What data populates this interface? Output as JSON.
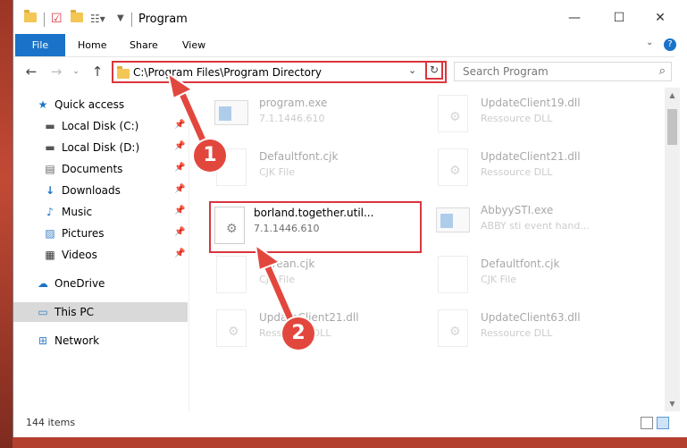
{
  "window": {
    "title": "Program",
    "controls": {
      "minimize": "—",
      "maximize": "☐",
      "close": "✕"
    }
  },
  "ribbon": {
    "tabs": [
      "File",
      "Home",
      "Share",
      "View"
    ],
    "help": "?"
  },
  "nav": {
    "address": "C:\\Program Files\\Program Directory",
    "search_placeholder": "Search Program"
  },
  "sidebar": {
    "items": [
      {
        "label": "Quick access",
        "icon": "star-icon",
        "pinned": false
      },
      {
        "label": "Local Disk (C:)",
        "icon": "drive-icon",
        "pinned": true
      },
      {
        "label": "Local Disk (D:)",
        "icon": "drive-icon",
        "pinned": true
      },
      {
        "label": "Documents",
        "icon": "document-icon",
        "pinned": true
      },
      {
        "label": "Downloads",
        "icon": "download-icon",
        "pinned": true
      },
      {
        "label": "Music",
        "icon": "music-icon",
        "pinned": true
      },
      {
        "label": "Pictures",
        "icon": "pictures-icon",
        "pinned": true
      },
      {
        "label": "Videos",
        "icon": "videos-icon",
        "pinned": true
      },
      {
        "label": "OneDrive",
        "icon": "cloud-icon",
        "pinned": false
      },
      {
        "label": "This PC",
        "icon": "computer-icon",
        "pinned": false
      },
      {
        "label": "Network",
        "icon": "network-icon",
        "pinned": false
      }
    ]
  },
  "files": [
    {
      "name": "program.exe",
      "desc": "7.1.1446.610"
    },
    {
      "name": "UpdateClient19.dll",
      "desc": "Ressource DLL"
    },
    {
      "name": "Defaultfont.cjk",
      "desc": "CJK File"
    },
    {
      "name": "UpdateClient21.dll",
      "desc": "Ressource DLL"
    },
    {
      "name": "borland.together.util...",
      "desc": "7.1.1446.610"
    },
    {
      "name": "AbbyySTI.exe",
      "desc": "ABBY sti event hand..."
    },
    {
      "name": "Korean.cjk",
      "desc": "CJK File"
    },
    {
      "name": "Defaultfont.cjk",
      "desc": "CJK File"
    },
    {
      "name": "UpdateClient21.dll",
      "desc": "Ressource DLL"
    },
    {
      "name": "UpdateClient63.dll",
      "desc": "Ressource DLL"
    }
  ],
  "status": {
    "items": "144 items"
  },
  "callouts": [
    "1",
    "2"
  ],
  "colors": {
    "accent": "#1a73c8",
    "highlight": "#d9363e",
    "selected_nav": "#d9d9d9"
  }
}
